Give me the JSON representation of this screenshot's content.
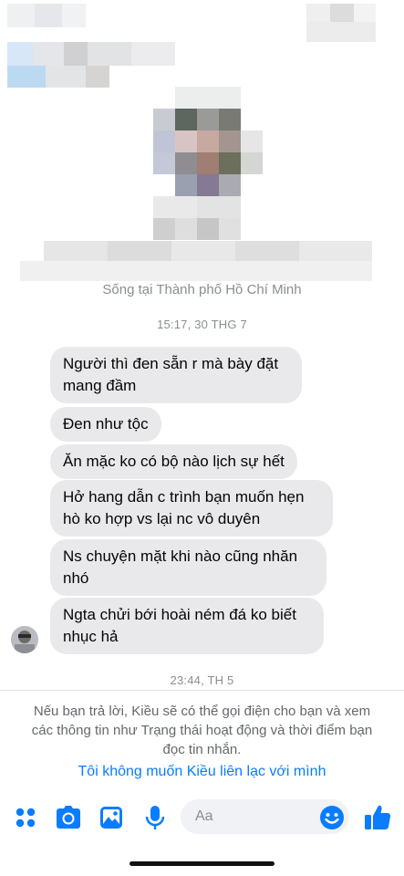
{
  "profile": {
    "location": "Sống tại Thành phố Hồ Chí Minh"
  },
  "thread": {
    "timestamp_1": "15:17, 30 THG 7",
    "messages": [
      "Người thì đen sẵn r mà bày đặt mang đầm",
      "Đen như tộc",
      "Ăn mặc ko có bộ nào lịch sự hết",
      "Hở hang dẫn c trình bạn muốn hẹn hò ko hợp vs lại nc vô duyên",
      "Ns chuyện mặt khi nào cũng nhăn nhó",
      "Ngta chửi bới hoài ném đá ko biết nhục hả"
    ],
    "timestamp_2": "23:44, TH 5"
  },
  "notice": {
    "text": "Nếu bạn trả lời, Kiều sẽ có thể gọi điện cho bạn và xem các thông tin như Trạng thái hoạt động và thời điểm bạn đọc tin nhắn.",
    "link": "Tôi không muốn Kiều liên lạc với mình"
  },
  "composer": {
    "placeholder": "Aa",
    "icons": [
      "apps-icon",
      "camera-icon",
      "photo-icon",
      "microphone-icon",
      "emoji-icon",
      "thumbs-up-icon"
    ],
    "accent_color": "#0a7cff"
  }
}
